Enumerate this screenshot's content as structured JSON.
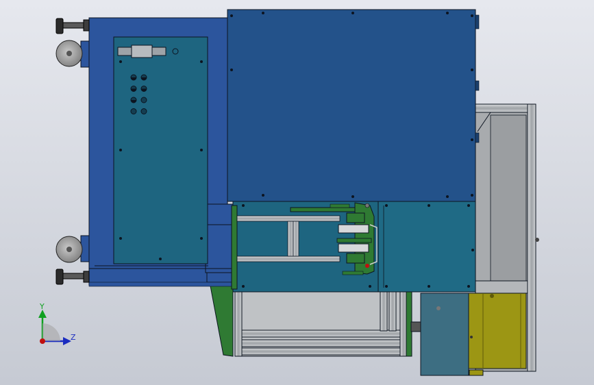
{
  "viewport": {
    "background_top": "#e6e8ee",
    "background_bottom": "#c6cad3"
  },
  "triad": {
    "y_label": "Y",
    "z_label": "Z",
    "y_color": "#10a020",
    "z_color": "#1a2cc0",
    "origin_color": "#c01010"
  },
  "colors": {
    "frame_blue": "#2c559d",
    "panel_blue": "#23528a",
    "teal": "#1e6580",
    "green": "#2f7a33",
    "gray_frame": "#a8abae",
    "motor_yellow": "#9c9614",
    "outline": "#0c1420"
  },
  "control_panel": {
    "button_rows": 4,
    "button_cols": 2
  }
}
